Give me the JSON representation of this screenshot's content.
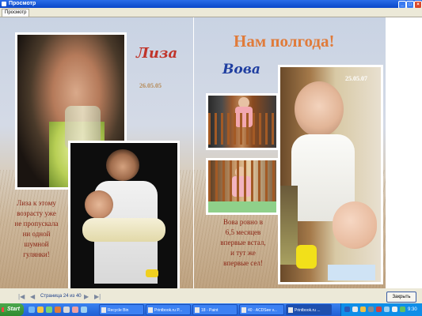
{
  "window": {
    "title": "Просмотр"
  },
  "tabs": [
    {
      "label": "Просмотр"
    }
  ],
  "left_page": {
    "name": "Лиза",
    "date": "26.05.05",
    "caption": [
      "Лиза к этому",
      "возрасту уже",
      "не пропускала",
      "ни одной",
      "шумной",
      "гулянки!"
    ]
  },
  "right_page": {
    "title": "Нам полгода!",
    "name": "Вова",
    "date": "25.05.07",
    "caption": [
      "Вова ровно в",
      "6,5 месяцев",
      "впервые встал,",
      "и тут же",
      "впервые сел!"
    ]
  },
  "navigation": {
    "page_info": "Страница 24 из 40",
    "first_icon": "first-page",
    "prev_icon": "prev-page",
    "next_icon": "next-page",
    "last_icon": "last-page",
    "close_label": "Закрыть"
  },
  "taskbar": {
    "start_label": "Start",
    "tasks": [
      {
        "label": "Recycle Bin"
      },
      {
        "label": "Printbook.ru P..."
      },
      {
        "label": "18 - Paint"
      },
      {
        "label": "40 - ACDSee v..."
      },
      {
        "label": "Printbook.ru ..."
      }
    ],
    "clock": "9:30"
  },
  "colors": {
    "name_lisa": "#c0342a",
    "name_vova": "#1f3ea0",
    "caption": "#8b2515",
    "heading": "#e07b3a",
    "date": "#b58a57"
  }
}
